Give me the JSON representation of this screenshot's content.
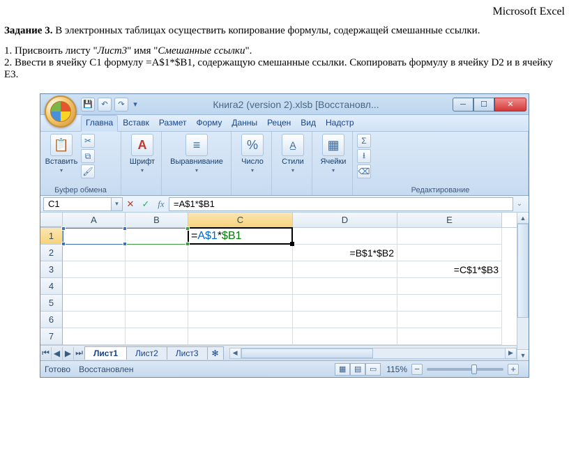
{
  "doc": {
    "header_right": "Microsoft Excel",
    "task_label": "Задание 3.",
    "task_text": " В электронных таблицах осуществить копирование формулы, содержащей смешанные ссылки.",
    "step1_a": "1. Присвоить листу \"",
    "step1_i1": "Лист3",
    "step1_b": "\" имя \"",
    "step1_i2": "Смешанные ссылки",
    "step1_c": "\".",
    "step2": "2. Ввести в ячейку C1 формулу =A$1*$B1, содержащую смешанные ссылки. Скопировать формулу в ячейку D2 и в ячейку E3."
  },
  "titlebar": {
    "title": "Книга2 (version 2).xlsb [Восстановл..."
  },
  "ribbon_tabs": [
    "Главна",
    "Вставк",
    "Размет",
    "Форму",
    "Данны",
    "Рецен",
    "Вид",
    "Надстр"
  ],
  "ribbon_groups": {
    "clipboard": {
      "paste": "Вставить",
      "label": "Буфер обмена"
    },
    "font": {
      "btn": "Шрифт"
    },
    "align": {
      "btn": "Выравнивание"
    },
    "number": {
      "btn": "Число"
    },
    "styles": {
      "btn": "Стили"
    },
    "cells": {
      "btn": "Ячейки"
    },
    "editing": {
      "label": "Редактирование"
    }
  },
  "namebox": "C1",
  "formula": "=A$1*$B1",
  "cols": [
    "A",
    "B",
    "C",
    "D",
    "E"
  ],
  "rows": [
    "1",
    "2",
    "3",
    "4",
    "5",
    "6",
    "7"
  ],
  "cells": {
    "C1_eq": "=",
    "C1_ref1": "A$1",
    "C1_star": "*",
    "C1_ref2": "$B1",
    "D2": "=B$1*$B2",
    "E3": "=C$1*$B3"
  },
  "sheet_tabs": [
    "Лист1",
    "Лист2",
    "Лист3"
  ],
  "status": {
    "ready": "Готово",
    "restored": "Восстановлен",
    "zoom": "115%"
  }
}
